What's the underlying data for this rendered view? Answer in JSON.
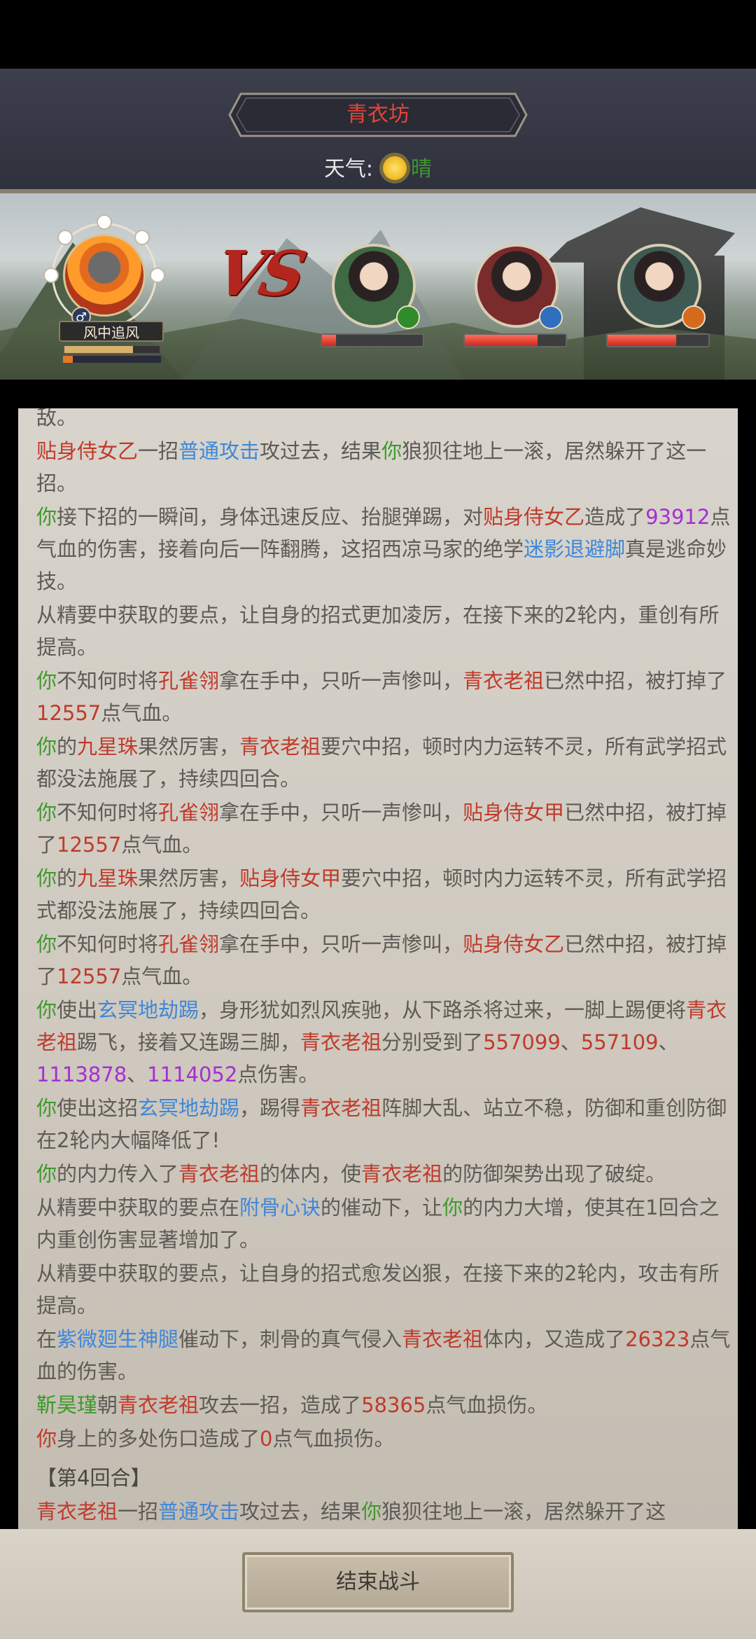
{
  "header": {
    "title": "青衣坊",
    "weather_label": "天气:",
    "weather_icon": "sun-icon",
    "weather_value": "晴"
  },
  "battle": {
    "vs_text": "VS",
    "player": {
      "name": "风中追风",
      "gender_icon": "male-icon",
      "gender_symbol": "♂",
      "bar1_fill": 0.72,
      "bar2_fill": 0.1
    },
    "enemies": [
      {
        "badge_icon": "green-element-icon",
        "badge_color": "#2f8c2a",
        "portrait_color": "#3f6a43",
        "hp_fill": 0.14
      },
      {
        "badge_icon": "blue-element-icon",
        "badge_color": "#2f6fbf",
        "portrait_color": "#7a2b2b",
        "hp_fill": 0.72
      },
      {
        "badge_icon": "orange-element-icon",
        "badge_color": "#d56a1c",
        "portrait_color": "#3f5a52",
        "hp_fill": 0.68
      }
    ]
  },
  "log": [
    {
      "cls": "",
      "parts": [
        {
          "t": "敌。",
          "c": ""
        }
      ]
    },
    {
      "cls": "",
      "parts": [
        {
          "t": "贴身侍女乙",
          "c": "red"
        },
        {
          "t": "一招",
          "c": ""
        },
        {
          "t": "普通攻击",
          "c": "blue"
        },
        {
          "t": "攻过去，结果",
          "c": ""
        },
        {
          "t": "你",
          "c": "green"
        },
        {
          "t": "狼狈往地上一滚，居然躲开了这一招。",
          "c": ""
        }
      ]
    },
    {
      "cls": "",
      "parts": [
        {
          "t": "你",
          "c": "green"
        },
        {
          "t": "接下招的一瞬间，身体迅速反应、抬腿弹踢，对",
          "c": ""
        },
        {
          "t": "贴身侍女乙",
          "c": "red"
        },
        {
          "t": "造成了",
          "c": ""
        },
        {
          "t": "93912",
          "c": "purple"
        },
        {
          "t": "点气血的伤害，接着向后一阵翻腾，这招西凉马家的绝学",
          "c": ""
        },
        {
          "t": "迷影退避脚",
          "c": "blue"
        },
        {
          "t": "真是逃命妙技。",
          "c": ""
        }
      ]
    },
    {
      "cls": "",
      "parts": [
        {
          "t": "从精要中获取的要点，让自身的招式更加凌厉，在接下来的2轮内，重创有所提高。",
          "c": ""
        }
      ]
    },
    {
      "cls": "",
      "parts": [
        {
          "t": "你",
          "c": "green"
        },
        {
          "t": "不知何时将",
          "c": ""
        },
        {
          "t": "孔雀翎",
          "c": "red"
        },
        {
          "t": "拿在手中，只听一声惨叫，",
          "c": ""
        },
        {
          "t": "青衣老祖",
          "c": "red"
        },
        {
          "t": "已然中招，被打掉了",
          "c": ""
        },
        {
          "t": "12557",
          "c": "red"
        },
        {
          "t": "点气血。",
          "c": ""
        }
      ]
    },
    {
      "cls": "",
      "parts": [
        {
          "t": "你",
          "c": "green"
        },
        {
          "t": "的",
          "c": ""
        },
        {
          "t": "九星珠",
          "c": "red"
        },
        {
          "t": "果然厉害，",
          "c": ""
        },
        {
          "t": "青衣老祖",
          "c": "red"
        },
        {
          "t": "要穴中招，顿时内力运转不灵，所有武学招式都没法施展了，持续四回合。",
          "c": ""
        }
      ]
    },
    {
      "cls": "",
      "parts": [
        {
          "t": "你",
          "c": "green"
        },
        {
          "t": "不知何时将",
          "c": ""
        },
        {
          "t": "孔雀翎",
          "c": "red"
        },
        {
          "t": "拿在手中，只听一声惨叫，",
          "c": ""
        },
        {
          "t": "贴身侍女甲",
          "c": "red"
        },
        {
          "t": "已然中招，被打掉了",
          "c": ""
        },
        {
          "t": "12557",
          "c": "red"
        },
        {
          "t": "点气血。",
          "c": ""
        }
      ]
    },
    {
      "cls": "",
      "parts": [
        {
          "t": "你",
          "c": "green"
        },
        {
          "t": "的",
          "c": ""
        },
        {
          "t": "九星珠",
          "c": "red"
        },
        {
          "t": "果然厉害，",
          "c": ""
        },
        {
          "t": "贴身侍女甲",
          "c": "red"
        },
        {
          "t": "要穴中招，顿时内力运转不灵，所有武学招式都没法施展了，持续四回合。",
          "c": ""
        }
      ]
    },
    {
      "cls": "",
      "parts": [
        {
          "t": "你",
          "c": "green"
        },
        {
          "t": "不知何时将",
          "c": ""
        },
        {
          "t": "孔雀翎",
          "c": "red"
        },
        {
          "t": "拿在手中，只听一声惨叫，",
          "c": ""
        },
        {
          "t": "贴身侍女乙",
          "c": "red"
        },
        {
          "t": "已然中招，被打掉了",
          "c": ""
        },
        {
          "t": "12557",
          "c": "red"
        },
        {
          "t": "点气血。",
          "c": ""
        }
      ]
    },
    {
      "cls": "",
      "parts": [
        {
          "t": "你",
          "c": "green"
        },
        {
          "t": "使出",
          "c": ""
        },
        {
          "t": "玄冥地劫踢",
          "c": "blue"
        },
        {
          "t": "，身形犹如烈风疾驰，从下路杀将过来，一脚上踢便将",
          "c": ""
        },
        {
          "t": "青衣老祖",
          "c": "red"
        },
        {
          "t": "踢飞，接着又连踢三脚，",
          "c": ""
        },
        {
          "t": "青衣老祖",
          "c": "red"
        },
        {
          "t": "分别受到了",
          "c": ""
        },
        {
          "t": "557099",
          "c": "red"
        },
        {
          "t": "、",
          "c": ""
        },
        {
          "t": "557109",
          "c": "red"
        },
        {
          "t": "、",
          "c": ""
        },
        {
          "t": "1113878",
          "c": "purple"
        },
        {
          "t": "、",
          "c": ""
        },
        {
          "t": "1114052",
          "c": "purple"
        },
        {
          "t": "点伤害。",
          "c": ""
        }
      ]
    },
    {
      "cls": "",
      "parts": [
        {
          "t": "你",
          "c": "green"
        },
        {
          "t": "使出这招",
          "c": ""
        },
        {
          "t": "玄冥地劫踢",
          "c": "blue"
        },
        {
          "t": "，踢得",
          "c": ""
        },
        {
          "t": "青衣老祖",
          "c": "red"
        },
        {
          "t": "阵脚大乱、站立不稳，防御和重创防御在2轮内大幅降低了!",
          "c": ""
        }
      ]
    },
    {
      "cls": "",
      "parts": [
        {
          "t": "你",
          "c": "green"
        },
        {
          "t": "的内力传入了",
          "c": ""
        },
        {
          "t": "青衣老祖",
          "c": "red"
        },
        {
          "t": "的体内，使",
          "c": ""
        },
        {
          "t": "青衣老祖",
          "c": "red"
        },
        {
          "t": "的防御架势出现了破绽。",
          "c": ""
        }
      ]
    },
    {
      "cls": "",
      "parts": [
        {
          "t": "从精要中获取的要点在",
          "c": ""
        },
        {
          "t": "附骨心诀",
          "c": "blue"
        },
        {
          "t": "的催动下，让",
          "c": ""
        },
        {
          "t": "你",
          "c": "green"
        },
        {
          "t": "的内力大增，使其在1回合之内重创伤害显著增加了。",
          "c": ""
        }
      ]
    },
    {
      "cls": "",
      "parts": [
        {
          "t": "从精要中获取的要点，让自身的招式愈发凶狠，在接下来的2轮内，攻击有所提高。",
          "c": ""
        }
      ]
    },
    {
      "cls": "",
      "parts": [
        {
          "t": "在",
          "c": ""
        },
        {
          "t": "紫微廻生神腿",
          "c": "blue"
        },
        {
          "t": "催动下，刺骨的真气侵入",
          "c": ""
        },
        {
          "t": "青衣老祖",
          "c": "red"
        },
        {
          "t": "体内，又造成了",
          "c": ""
        },
        {
          "t": "26323",
          "c": "red"
        },
        {
          "t": "点气血的伤害。",
          "c": ""
        }
      ]
    },
    {
      "cls": "",
      "parts": [
        {
          "t": "靳昊瑾",
          "c": "green"
        },
        {
          "t": "朝",
          "c": ""
        },
        {
          "t": "青衣老祖",
          "c": "red"
        },
        {
          "t": "攻去一招，造成了",
          "c": ""
        },
        {
          "t": "58365",
          "c": "red"
        },
        {
          "t": "点气血损伤。",
          "c": ""
        }
      ]
    },
    {
      "cls": "",
      "parts": [
        {
          "t": "你",
          "c": "red"
        },
        {
          "t": "身上的多处伤口造成了",
          "c": ""
        },
        {
          "t": "0",
          "c": "red"
        },
        {
          "t": "点气血损伤。",
          "c": ""
        }
      ]
    },
    {
      "cls": "round",
      "parts": [
        {
          "t": "【第4回合】",
          "c": "dark"
        }
      ]
    },
    {
      "cls": "",
      "parts": [
        {
          "t": "青衣老祖",
          "c": "red"
        },
        {
          "t": "一招",
          "c": ""
        },
        {
          "t": "普通攻击",
          "c": "blue"
        },
        {
          "t": "攻过去，结果",
          "c": ""
        },
        {
          "t": "你",
          "c": "green"
        },
        {
          "t": "狼狈往地上一滚，居然躲开了这",
          "c": ""
        }
      ]
    }
  ],
  "footer": {
    "end_battle_label": "结束战斗"
  }
}
